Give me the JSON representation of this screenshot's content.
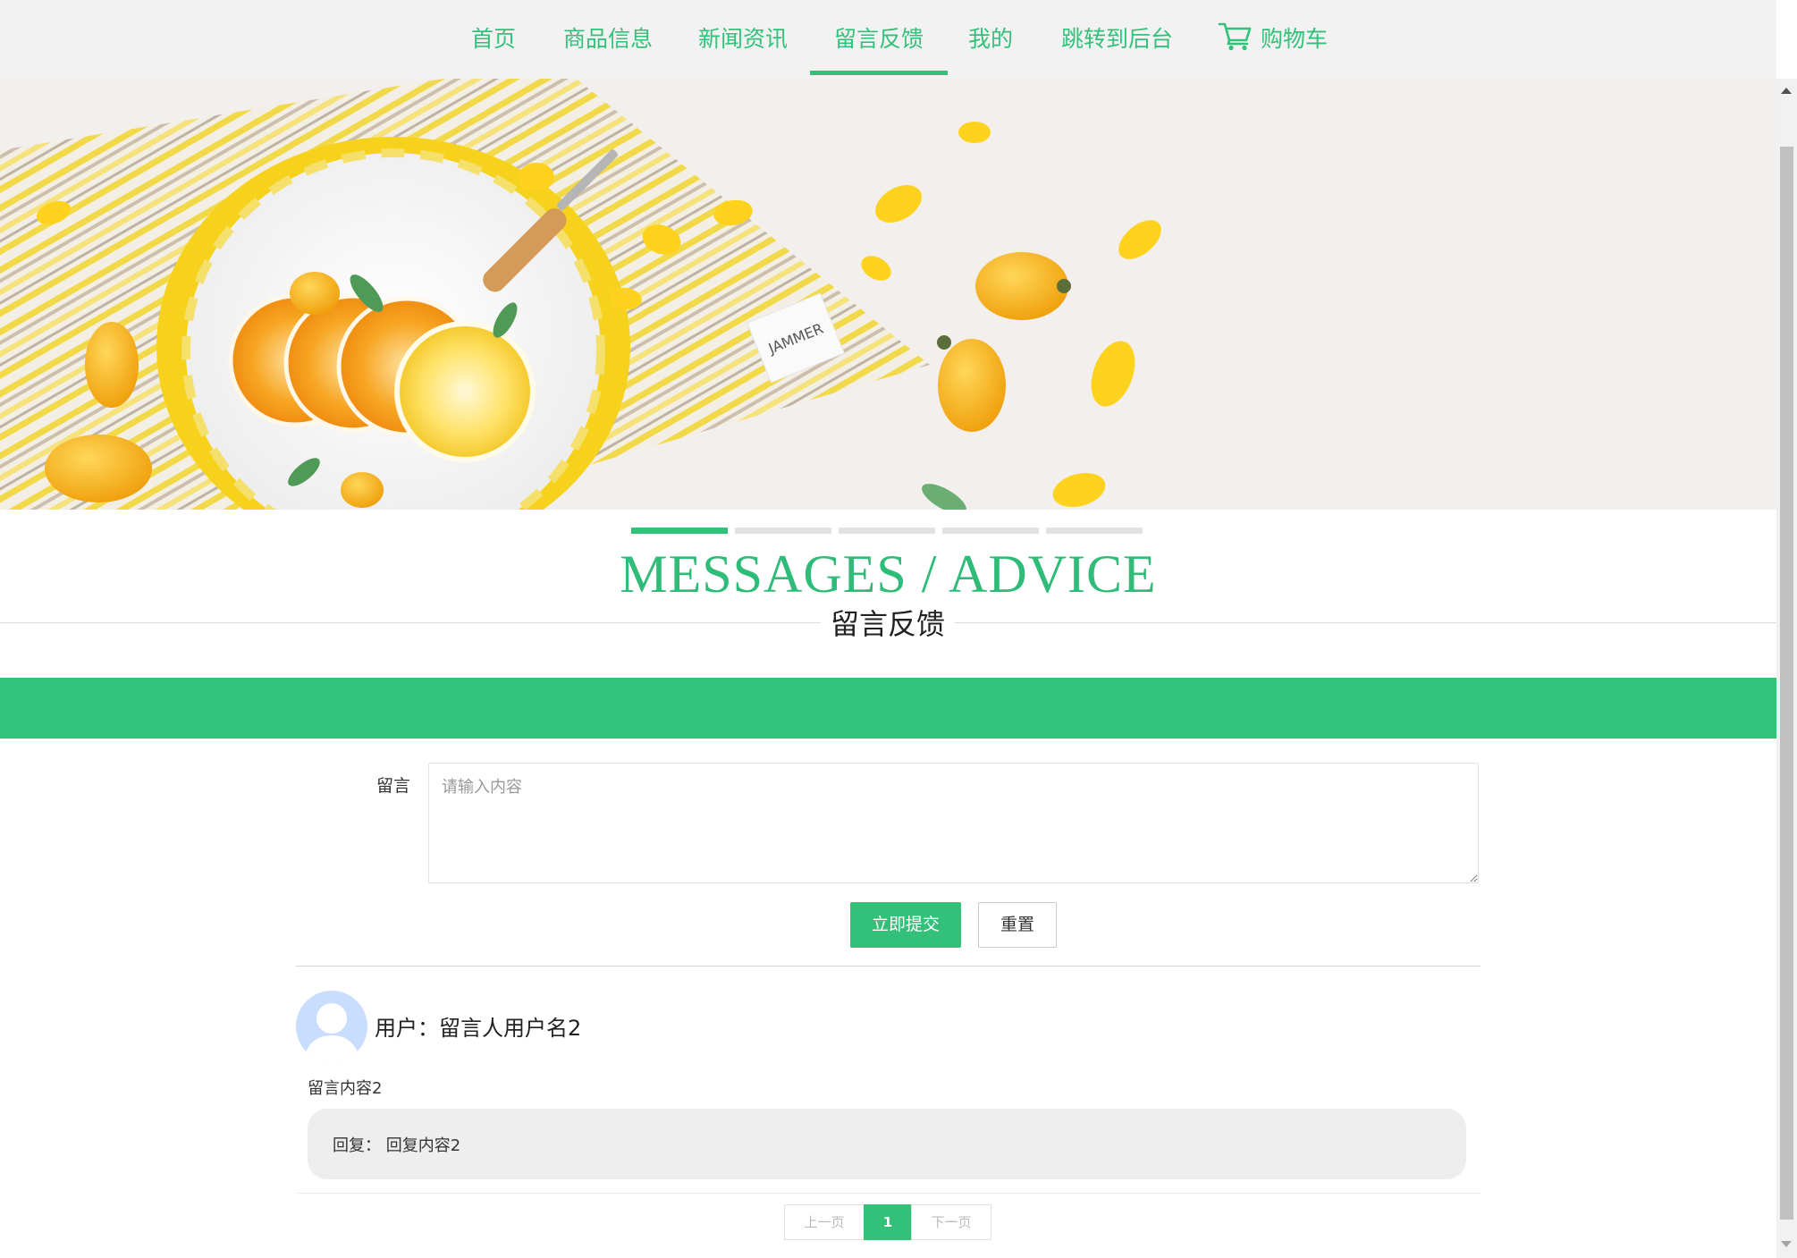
{
  "nav": {
    "items": [
      {
        "label": "首页"
      },
      {
        "label": "商品信息"
      },
      {
        "label": "新闻资讯"
      },
      {
        "label": "留言反馈"
      },
      {
        "label": "我的"
      },
      {
        "label": "跳转到后台"
      },
      {
        "label": "购物车",
        "icon": "cart-icon"
      }
    ],
    "active_label": "留言反馈"
  },
  "banner": {
    "slide_count": 5,
    "active_slide": 1,
    "napkin_tag": "JAMMER"
  },
  "section": {
    "title_en": "MESSAGES / ADVICE",
    "title_cn": "留言反馈"
  },
  "form": {
    "label": "留言",
    "placeholder": "请输入内容",
    "value": "",
    "submit_label": "立即提交",
    "reset_label": "重置"
  },
  "messages": [
    {
      "user": "用户：留言人用户名2",
      "content": "留言内容2",
      "reply": "回复：  回复内容2",
      "avatar_icon": "user-avatar-icon"
    }
  ],
  "pagination": {
    "prev_label": "上一页",
    "current": "1",
    "next_label": "下一页"
  },
  "colors": {
    "accent": "#33c17a",
    "nav_background": "#f2f2f2",
    "reply_background": "#eeeeee",
    "avatar": "#c9ddff"
  }
}
